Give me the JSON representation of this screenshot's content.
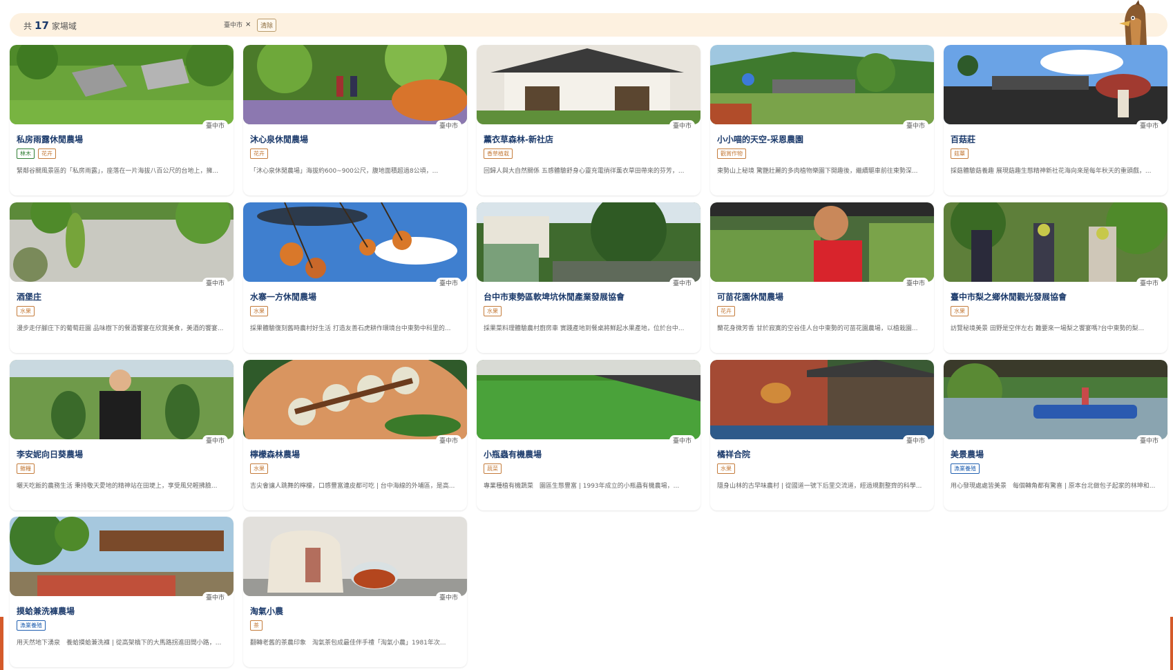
{
  "header": {
    "count_prefix": "共",
    "count": "17",
    "count_suffix": "家場域",
    "filter_region": "臺中市",
    "filter_remove": "×",
    "clear_label": "清除"
  },
  "cards": [
    {
      "name": "私房雨露休閒農場",
      "region": "臺中市",
      "tags": [
        "林木",
        "花卉"
      ],
      "tag_colors": [
        "green",
        "orange"
      ],
      "desc": "緊鄰谷關風景區的「私房雨露」，座落在一片海拔八百公尺的台地上，擁..."
    },
    {
      "name": "沐心泉休閒農場",
      "region": "臺中市",
      "tags": [
        "花卉"
      ],
      "tag_colors": [
        "orange"
      ],
      "desc": "「沐心泉休閒農場」海拔約600~900公尺，腹地面積超過8公頃，..."
    },
    {
      "name": "薰衣草森林-新社店",
      "region": "臺中市",
      "tags": [
        "香草植栽"
      ],
      "tag_colors": [
        "orange"
      ],
      "desc": "回歸人與大自然關係 五感體驗舒身心靈充電徜徉薰衣草田帶來的芬芳，..."
    },
    {
      "name": "小小喵的天空-采恩農園",
      "region": "臺中市",
      "tags": [
        "觀賞作物"
      ],
      "tag_colors": [
        "orange"
      ],
      "desc": "東勢山上秘境 驚艷壯麗的多肉植物樂園下開趣後，繼續驅車前往東勢深..."
    },
    {
      "name": "百菇莊",
      "region": "臺中市",
      "tags": [
        "菇蕈"
      ],
      "tag_colors": [
        "orange"
      ],
      "desc": "採菇體驗菇養趣 展現菇趣生態精神新社花海向來是每年秋天的重頭戲，..."
    },
    {
      "name": "酒堡庄",
      "region": "臺中市",
      "tags": [
        "水果"
      ],
      "tag_colors": [
        "orange"
      ],
      "desc": "漫步走仔腳庄下的葡萄莊園 品味樹下的餐酒饗宴在欣賞美食，美酒的饗宴..."
    },
    {
      "name": "水寨一方休閒農場",
      "region": "臺中市",
      "tags": [
        "水果"
      ],
      "tag_colors": [
        "orange"
      ],
      "desc": "採果體驗復刻舊時農村好生活 打造友善石虎耕作環境台中東勢中科里的..."
    },
    {
      "name": "台中市東勢區軟埤坑休閒產業發展協會",
      "region": "臺中市",
      "tags": [
        "水果"
      ],
      "tag_colors": [
        "orange"
      ],
      "desc": "採果菜料理體驗農村廚房車 實踐產地到餐桌將鮮起水果產地，位於台中..."
    },
    {
      "name": "可苗花園休閒農場",
      "region": "臺中市",
      "tags": [
        "花卉"
      ],
      "tag_colors": [
        "orange"
      ],
      "desc": "蘭花身微芳香 甘於寂寞的空谷佳人台中東勢的可苗花園農場，以植栽園..."
    },
    {
      "name": "臺中市梨之鄉休閒觀光發展協會",
      "region": "臺中市",
      "tags": [
        "水果"
      ],
      "tag_colors": [
        "orange"
      ],
      "desc": "訪覽秘境美景 田野是空伴左右 難要來一場梨之饗宴嗎?台中東勢的梨..."
    },
    {
      "name": "李安妮向日葵農場",
      "region": "臺中市",
      "tags": [
        "雜糧"
      ],
      "tag_colors": [
        "orange"
      ],
      "desc": "曬天吃飯的農務生活 秉持敬天愛地的精神站在田埂上，享受風兒輕拂臉..."
    },
    {
      "name": "檸檬森林農場",
      "region": "臺中市",
      "tags": [
        "水果"
      ],
      "tag_colors": [
        "orange"
      ],
      "desc": "吉尖會讓人跳舞的檸檬，口感豐富連皮都可吃 | 台中海線的外埔區，是高..."
    },
    {
      "name": "小瓶蟲有機農場",
      "region": "臺中市",
      "tags": [
        "蔬菜"
      ],
      "tag_colors": [
        "orange"
      ],
      "desc": "專業種植有機蔬菜　園區生態豐富 | 1993年成立的小瓶蟲有機農場，..."
    },
    {
      "name": "橘祥合院",
      "region": "臺中市",
      "tags": [
        "水果"
      ],
      "tag_colors": [
        "orange"
      ],
      "desc": "隱身山林的古早味農村 | 從國道一號下后里交流道，經過規劃整齊的科學..."
    },
    {
      "name": "美景農場",
      "region": "臺中市",
      "tags": [
        "漁業養殖"
      ],
      "tag_colors": [
        "blue"
      ],
      "desc": "用心發現處處皆美景　每個轉角都有驚喜 | 原本台北做包子起家的林坤和..."
    },
    {
      "name": "摸蛤兼洗褲農場",
      "region": "臺中市",
      "tags": [
        "漁業養殖"
      ],
      "tag_colors": [
        "blue"
      ],
      "desc": "用天然地下湧泉　養蛤摸蛤兼洗褲 | 從高架橋下的大馬路拐進田間小路，..."
    },
    {
      "name": "淘氣小農",
      "region": "臺中市",
      "tags": [
        "茶"
      ],
      "tag_colors": [
        "orange"
      ],
      "desc": "翻轉老舊的茶農印象　淘氣茶包成最佳伴手禮「淘氣小農」1981年次..."
    }
  ]
}
